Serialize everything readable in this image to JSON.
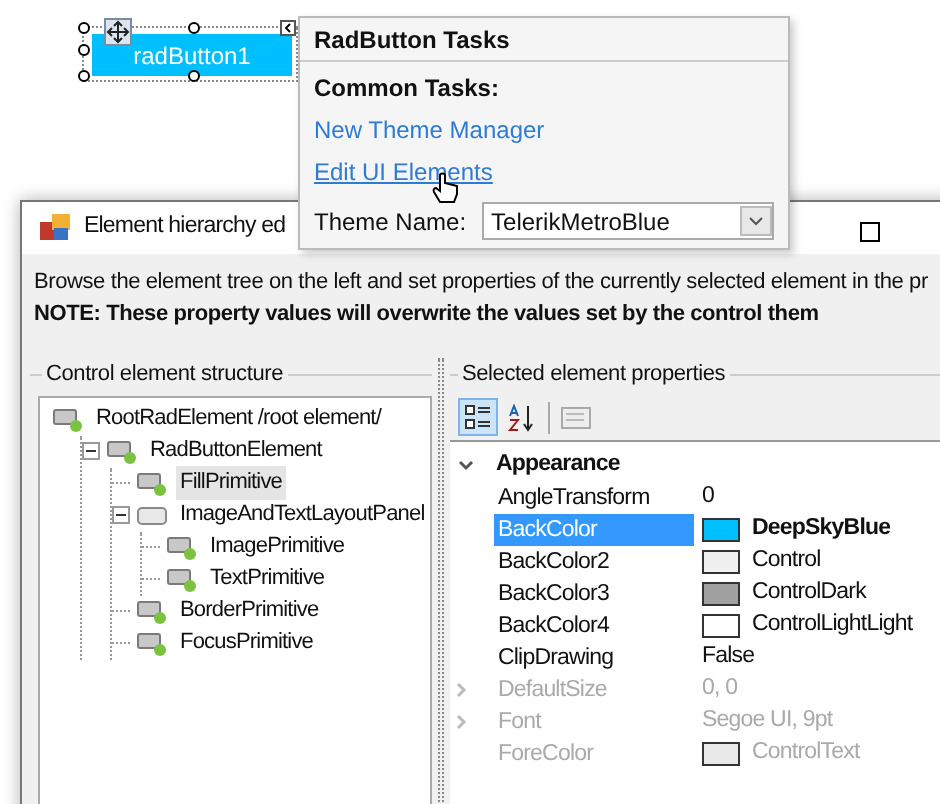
{
  "designer_button": {
    "label": "radButton1"
  },
  "tasks_panel": {
    "title": "RadButton Tasks",
    "section": "Common Tasks:",
    "links": [
      "New Theme Manager",
      "Edit UI Elements"
    ],
    "theme_label": "Theme Name:",
    "theme_value": "TelerikMetroBlue"
  },
  "dialog": {
    "title": "Element hierarchy ed",
    "description": "Browse the element tree on the left and set properties of the currently selected element in the pr",
    "note": "NOTE: These property values will overwrite the values set by the control them",
    "tree_group": "Control element structure",
    "tree": [
      {
        "label": "RootRadElement /root element/",
        "selected": false,
        "children": [
          {
            "label": "RadButtonElement",
            "selected": false,
            "expanded": true,
            "children": [
              {
                "label": "FillPrimitive",
                "selected": true
              },
              {
                "label": "ImageAndTextLayoutPanel",
                "selected": false,
                "expanded": true,
                "children": [
                  {
                    "label": "ImagePrimitive",
                    "selected": false
                  },
                  {
                    "label": "TextPrimitive",
                    "selected": false
                  }
                ]
              },
              {
                "label": "BorderPrimitive",
                "selected": false
              },
              {
                "label": "FocusPrimitive",
                "selected": false
              }
            ]
          }
        ]
      }
    ],
    "props_group": "Selected element properties",
    "toolbar": [
      {
        "kind": "categorized",
        "selected": true
      },
      {
        "kind": "alphabetical",
        "selected": false
      },
      {
        "kind": "pages",
        "selected": false
      }
    ],
    "category": "Appearance",
    "properties": [
      {
        "name": "AngleTransform",
        "value": "0",
        "selected": false,
        "faded": false
      },
      {
        "name": "BackColor",
        "value": "DeepSkyBlue",
        "color": "#00bfff",
        "selected": true,
        "bold": true,
        "faded": false
      },
      {
        "name": "BackColor2",
        "value": "Control",
        "color": "#f0f0f0",
        "selected": false,
        "faded": false
      },
      {
        "name": "BackColor3",
        "value": "ControlDark",
        "color": "#a0a0a0",
        "selected": false,
        "faded": false
      },
      {
        "name": "BackColor4",
        "value": "ControlLightLight",
        "color": "#ffffff",
        "selected": false,
        "faded": false
      },
      {
        "name": "ClipDrawing",
        "value": "False",
        "selected": false,
        "faded": false
      },
      {
        "name": "DefaultSize",
        "value": "0, 0",
        "selected": false,
        "faded": true,
        "expandable": true
      },
      {
        "name": "Font",
        "value": "Segoe UI, 9pt",
        "selected": false,
        "faded": true,
        "expandable": true
      },
      {
        "name": "ForeColor",
        "value": "ControlText",
        "color": "#e8e8e8",
        "selected": false,
        "faded": true
      }
    ]
  }
}
